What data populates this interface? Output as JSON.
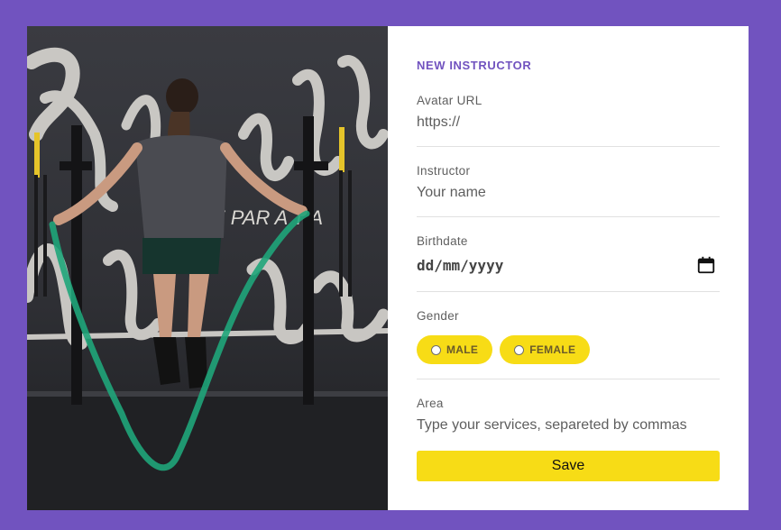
{
  "form": {
    "title": "NEW INSTRUCTOR",
    "avatar": {
      "label": "Avatar URL",
      "placeholder": "https://"
    },
    "instructor": {
      "label": "Instructor",
      "placeholder": "Your name"
    },
    "birthdate": {
      "label": "Birthdate",
      "placeholder": "dd/mm/yyyy"
    },
    "gender": {
      "label": "Gender",
      "options": [
        {
          "label": "MALE",
          "selected": false
        },
        {
          "label": "FEMALE",
          "selected": false
        }
      ]
    },
    "area": {
      "label": "Area",
      "placeholder": "Type your services, separeted by commas"
    },
    "save_label": "Save"
  },
  "icons": {
    "birthdate": "calendar-icon"
  },
  "colors": {
    "background": "#7153bf",
    "accent": "#7153bf",
    "button": "#f7dc16",
    "card": "#ffffff"
  }
}
